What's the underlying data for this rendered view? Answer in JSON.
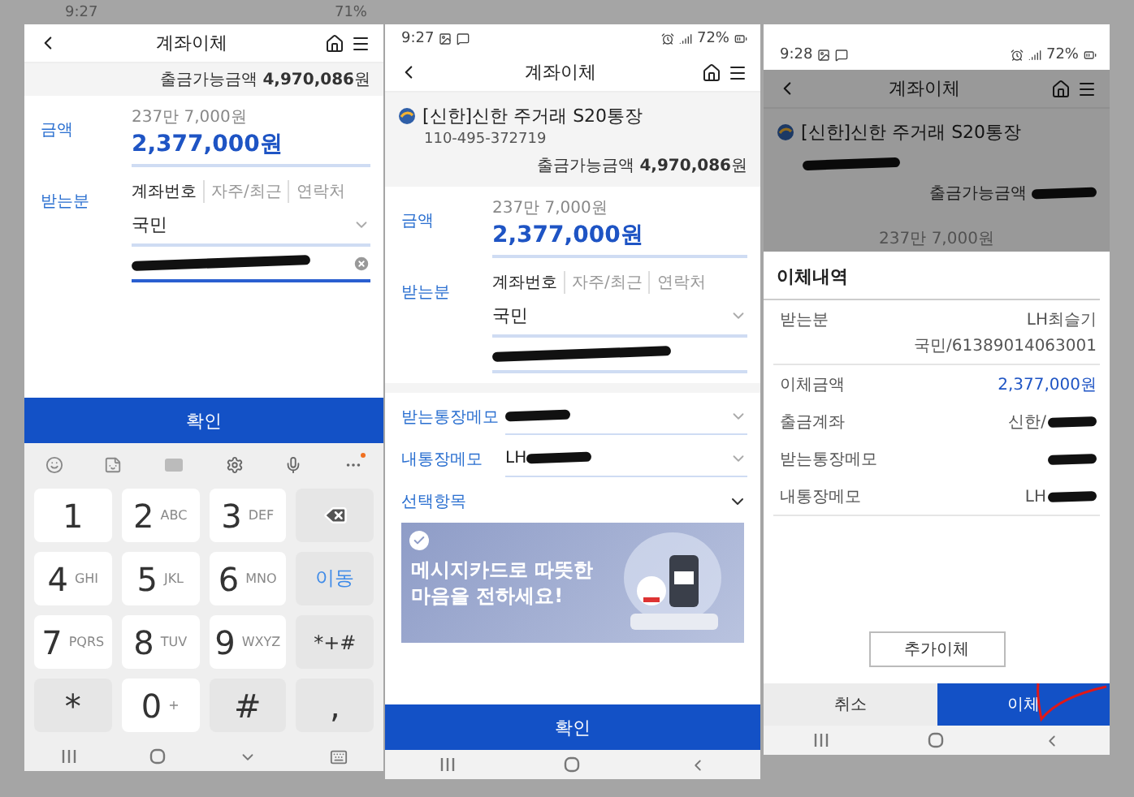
{
  "screen_1": {
    "status_bar": {
      "time": "9:27",
      "battery": "71%"
    },
    "header": {
      "title": "계좌이체"
    },
    "balance": "출금가능금액 **4,970,086**원",
    "amount": {
      "label": "금액",
      "hint": "237만 7,000원",
      "value": "2,377,000원"
    },
    "recipient": {
      "label": "받는분",
      "tabs": [
        {
          "label": "계좌번호",
          "selected": true
        },
        {
          "label": "자주/최근",
          "selected": false
        },
        {
          "label": "연락처",
          "selected": false
        }
      ],
      "bank": "국민",
      "account": {
        "redacted": true
      }
    },
    "confirm_button": "확인",
    "keypad": [
      {
        "kind": "digit",
        "main": "1"
      },
      {
        "kind": "digit",
        "main": "2",
        "sub": "ABC"
      },
      {
        "kind": "digit",
        "main": "3",
        "sub": "DEF"
      },
      {
        "kind": "backspace"
      },
      {
        "kind": "digit",
        "main": "4",
        "sub": "GHI"
      },
      {
        "kind": "digit",
        "main": "5",
        "sub": "JKL"
      },
      {
        "kind": "digit",
        "main": "6",
        "sub": "MNO"
      },
      {
        "kind": "accent",
        "main": "이동"
      },
      {
        "kind": "digit",
        "main": "7",
        "sub": "PQRS"
      },
      {
        "kind": "digit",
        "main": "8",
        "sub": "TUV"
      },
      {
        "kind": "digit",
        "main": "9",
        "sub": "WXYZ"
      },
      {
        "kind": "function",
        "main": "*+#"
      },
      {
        "kind": "function",
        "main": "*"
      },
      {
        "kind": "digit",
        "main": "0",
        "sub": "+"
      },
      {
        "kind": "function",
        "main": "#"
      },
      {
        "kind": "function",
        "main": ","
      }
    ]
  },
  "screen_2": {
    "status_bar": {
      "time": "9:27",
      "battery": "72%"
    },
    "header": {
      "title": "계좌이체"
    },
    "account": {
      "name": "[신한]신한 주거래 S20통장",
      "number": "110-495-372719",
      "balance": "출금가능금액 **4,970,086**원"
    },
    "amount": {
      "label": "금액",
      "hint": "237만 7,000원",
      "value": "2,377,000원"
    },
    "recipient": {
      "label": "받는분",
      "tabs": [
        {
          "label": "계좌번호",
          "selected": true
        },
        {
          "label": "자주/최근",
          "selected": false
        },
        {
          "label": "연락처",
          "selected": false
        }
      ],
      "bank": "국민",
      "account": {
        "redacted": true
      }
    },
    "memos": [
      {
        "label": "받는통장메모",
        "redacted": true
      },
      {
        "label": "내통장메모",
        "text": "LH",
        "redacted": true
      }
    ],
    "optional_section": "선택항목",
    "banner": {
      "lines": [
        "메시지카드로 따뜻한",
        "마음을 전하세요!"
      ]
    },
    "confirm_button": "확인"
  },
  "screen_3": {
    "status_bar": {
      "time": "9:28",
      "battery": "72%"
    },
    "header": {
      "title": "계좌이체"
    },
    "account": {
      "name": "[신한]신한 주거래 S20통장",
      "number_redacted": true,
      "balance_label": "출금가능금액",
      "balance_redacted": true
    },
    "amount_hint": "237만 7,000원",
    "sheet": {
      "title": "이체내역",
      "rows": [
        {
          "kind": "recipient",
          "label": "받는분",
          "lines": [
            "LH최슬기",
            "국민/61389014063001"
          ]
        },
        {
          "kind": "amount",
          "label": "이체금액",
          "value": "2,377,000원"
        },
        {
          "kind": "plain",
          "label": "출금계좌",
          "value": "신한/",
          "redacted": true
        },
        {
          "kind": "plain",
          "label": "받는통장메모",
          "redacted": true
        },
        {
          "kind": "plain",
          "label": "내통장메모",
          "value": "LH",
          "redacted": true
        }
      ],
      "add_button": "추가이체",
      "cancel_button": "취소",
      "submit_button": "이체"
    }
  }
}
